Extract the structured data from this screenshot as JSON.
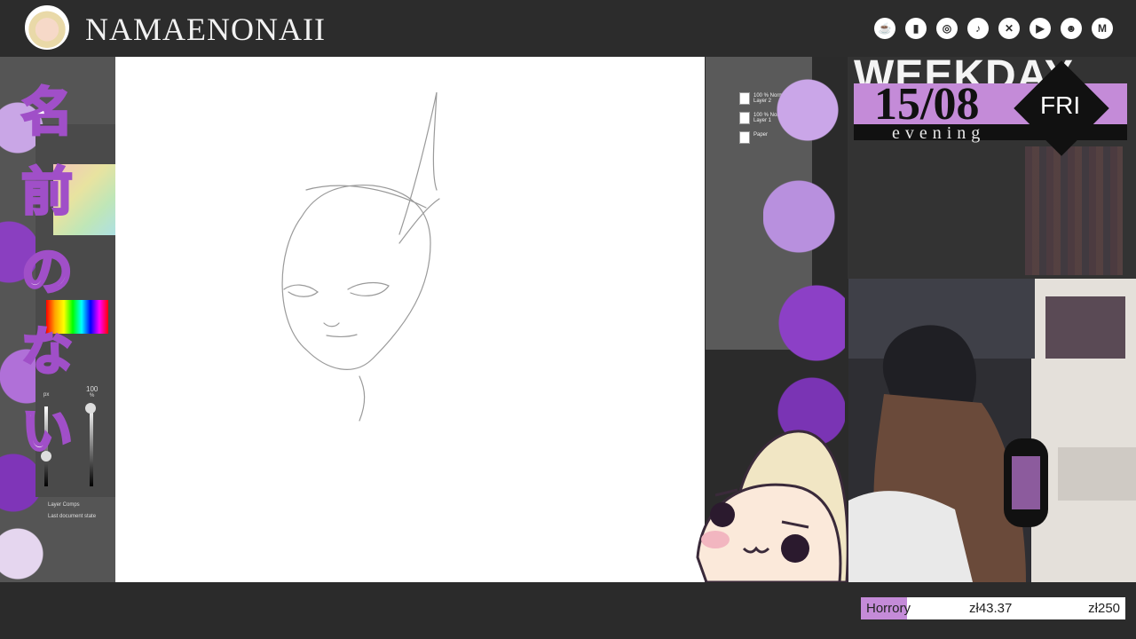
{
  "header": {
    "channel_name": "NAMAENONAII",
    "social_icons": [
      "kofi-icon",
      "twitch-icon",
      "instagram-icon",
      "tiktok-icon",
      "x-icon",
      "youtube-icon",
      "discord-icon",
      "gmail-icon"
    ]
  },
  "left_overlay": {
    "vertical_text": [
      "名",
      "前",
      "の",
      "な",
      "い"
    ],
    "brush_size_value": "100",
    "brush_size_unit": "%",
    "size_unit": "px",
    "layer_comps_label": "Layer Comps",
    "document_state_label": "Last document state"
  },
  "layers": [
    {
      "opacity_mode": "100 % Normal",
      "name": "Layer 2"
    },
    {
      "opacity_mode": "100 % Normal",
      "name": "Layer 1"
    },
    {
      "opacity_mode": "",
      "name": "Paper"
    }
  ],
  "schedule": {
    "weekday_word": "WEEKDAY",
    "date": "15/08",
    "day": "FRI",
    "time_of_day": "evening"
  },
  "goal_bar": {
    "label": "Horrory",
    "current": "zł43.37",
    "target": "zł250",
    "progress_fraction": 0.1735,
    "fill_color": "#c48bd8"
  },
  "colors": {
    "accent_purple": "#c48bd8",
    "topbar_bg": "#2c2c2c"
  }
}
